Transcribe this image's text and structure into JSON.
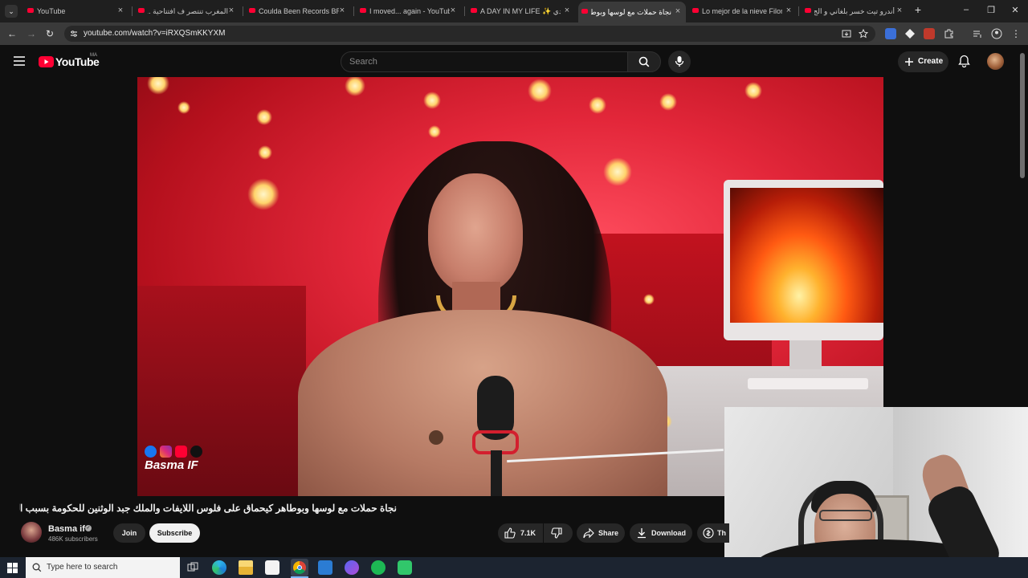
{
  "browser": {
    "tabs": [
      {
        "title": "YouTube"
      },
      {
        "title": "المغرب تنتصر ف افتتاحية ..."
      },
      {
        "title": "Coulda Been Records BRO"
      },
      {
        "title": "I moved... again - YouTub"
      },
      {
        "title": "A DAY IN MY LIFE ✨ عيدي"
      },
      {
        "title": "نجاة حملات مع لوسها وبوط"
      },
      {
        "title": "Lo mejor de la nieve Filon"
      },
      {
        "title": "أندرو تيت خسر بلغاني و الج"
      }
    ],
    "active_tab_index": 5,
    "url": "youtube.com/watch?v=iRXQSmKKYXM"
  },
  "youtube": {
    "logo_text": "YouTube",
    "region": "MA",
    "search_placeholder": "Search",
    "create_label": "Create",
    "video": {
      "watermark": "Basma IF",
      "title": "نجاة حملات مع لوسها وبوطاهر كيحماق على فلوس اللايفات والملك جبد الوثنين للحكومة بسبب الناس دأسفي"
    },
    "channel": {
      "name": "Basma if",
      "subscribers": "486K subscribers",
      "join_label": "Join",
      "subscribe_label": "Subscribe"
    },
    "actions": {
      "likes": "7.1K",
      "share_label": "Share",
      "download_label": "Download",
      "thanks_label": "Th"
    }
  },
  "taskbar": {
    "search_placeholder": "Type here to search"
  }
}
